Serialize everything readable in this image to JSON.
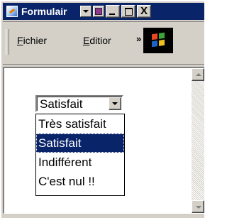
{
  "window": {
    "title": "Formulair"
  },
  "menubar": {
    "items": [
      {
        "label_u": "F",
        "label_rest": "ichier"
      },
      {
        "label_u": "E",
        "label_rest": "ditior"
      }
    ],
    "overflow": "»"
  },
  "titlebar_buttons": {
    "close": "X"
  },
  "form": {
    "select": {
      "value": "Satisfait",
      "options": [
        "Très satisfait",
        "Satisfait",
        "Indifférent",
        "C'est nul !!"
      ],
      "selected_index": 1
    }
  },
  "colors": {
    "titlebar": "#0a246a",
    "selection": "#0a246a",
    "chrome": "#d4d0c8"
  }
}
